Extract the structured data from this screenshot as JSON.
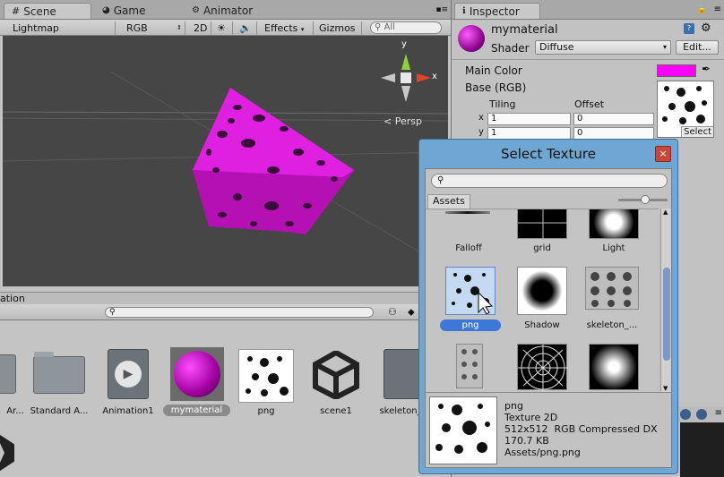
{
  "scene_tabs": [
    {
      "label": "Scene"
    },
    {
      "label": "Game"
    },
    {
      "label": "Animator"
    }
  ],
  "scene_toolbar": {
    "render_mode": "Lightmap Resolution",
    "color_mode": "RGB",
    "mode_2d": "2D",
    "effects": "Effects",
    "gizmos": "Gizmos",
    "search_placeholder": "All"
  },
  "gizmo": {
    "y_label": "y",
    "x_label": "x",
    "persp_label": "Persp"
  },
  "inspector": {
    "tab_label": "Inspector",
    "material_name": "mymaterial",
    "shader_label": "Shader",
    "shader_value": "Diffuse",
    "edit_button": "Edit...",
    "main_color_label": "Main Color",
    "main_color": "#ff00ff",
    "base_label": "Base (RGB)",
    "tiling_label": "Tiling",
    "offset_label": "Offset",
    "x_label": "x",
    "y_label": "y",
    "tiling_x": "1",
    "tiling_y": "1",
    "offset_x": "0",
    "offset_y": "0",
    "select_button": "Select"
  },
  "project": {
    "panel_label": "ation",
    "items": [
      {
        "label": "Ar..."
      },
      {
        "label": "Standard A..."
      },
      {
        "label": "Animation1"
      },
      {
        "label": "mymaterial"
      },
      {
        "label": "png"
      },
      {
        "label": "scene1"
      },
      {
        "label": "skeleton_"
      }
    ]
  },
  "dialog": {
    "title": "Select Texture",
    "close": "×",
    "assets_tab": "Assets",
    "slider_value": 0.55,
    "items": [
      {
        "label": "Falloff"
      },
      {
        "label": "grid"
      },
      {
        "label": "Light"
      },
      {
        "label": "png"
      },
      {
        "label": "Shadow"
      },
      {
        "label": "skeleton_..."
      },
      {
        "label": ""
      },
      {
        "label": ""
      },
      {
        "label": ""
      }
    ],
    "preview": {
      "name": "png",
      "type": "Texture 2D",
      "format": "512x512  RGB Compressed DX",
      "size": "170.7 KB",
      "path": "Assets/png.png"
    }
  }
}
